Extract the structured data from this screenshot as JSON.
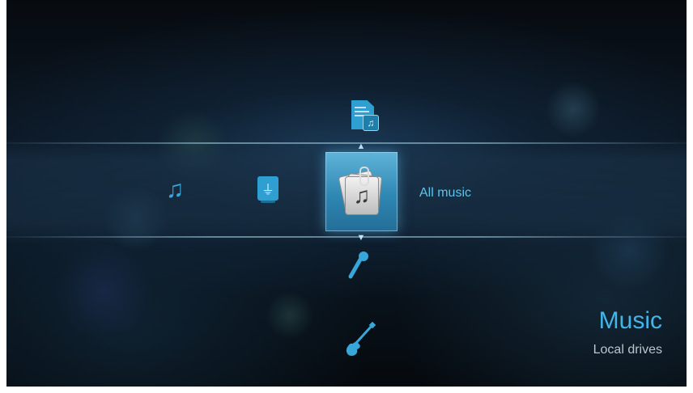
{
  "menu": {
    "selected_label": "All music",
    "left_items": [
      {
        "icon": "music-note-icon"
      },
      {
        "icon": "usb-drive-icon"
      }
    ],
    "vertical_items": [
      {
        "icon": "music-file-icon"
      },
      {
        "icon": "all-music-icon",
        "selected": true
      },
      {
        "icon": "microphone-icon"
      },
      {
        "icon": "guitar-icon"
      }
    ]
  },
  "category": {
    "title": "Music",
    "subtitle": "Local drives"
  },
  "colors": {
    "accent": "#38a6d8",
    "highlight": "#2f87b3",
    "text_secondary": "#b8c6cf"
  }
}
